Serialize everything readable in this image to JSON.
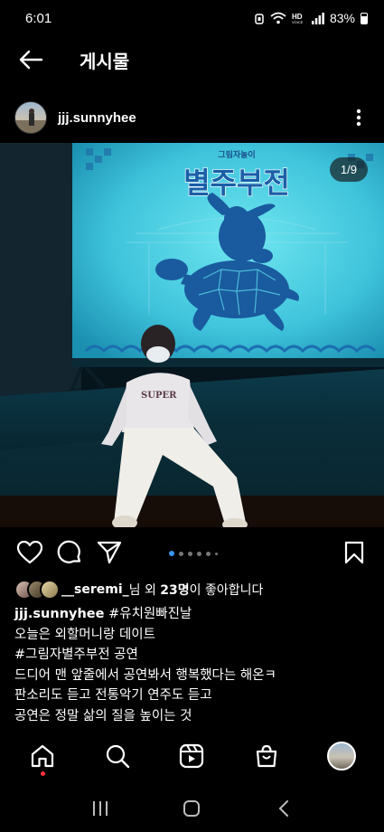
{
  "status_bar": {
    "time": "6:01",
    "battery": "83%",
    "icons": [
      "alarm-icon",
      "wifi-icon",
      "hd-voice-icon",
      "signal-icon",
      "battery-icon"
    ]
  },
  "header": {
    "title": "게시물",
    "back_icon": "arrow-left-icon"
  },
  "post": {
    "author": "jjj.sunnyhee",
    "page_counter": "1/9",
    "carousel": {
      "current": 1,
      "total": 9
    },
    "image": {
      "poster_small": "그림자놀이",
      "poster_title": "별주부전"
    },
    "likes": {
      "first_liker": "__seremi_",
      "text_mid": "님 외 ",
      "count": "23명",
      "text_end": "이 좋아합니다"
    },
    "caption": {
      "username": "jjj.sunnyhee",
      "first_tag": "#유치원빠진날",
      "lines": [
        "오늘은 외할머니랑 데이트",
        "#그림자별주부전 공연",
        "드디어 맨 앞줄에서 공연봐서 행복했다는 해온ㅋ",
        "판소리도 듣고 전통악기 연주도 듣고",
        "공연은 정말 삶의 질을 높이는 것"
      ]
    }
  },
  "bottom_nav": [
    "home-icon",
    "search-icon",
    "reels-icon",
    "shop-icon",
    "profile-avatar"
  ],
  "colors": {
    "background": "#000000",
    "accent": "#3897f0",
    "notification": "#ff3040"
  }
}
